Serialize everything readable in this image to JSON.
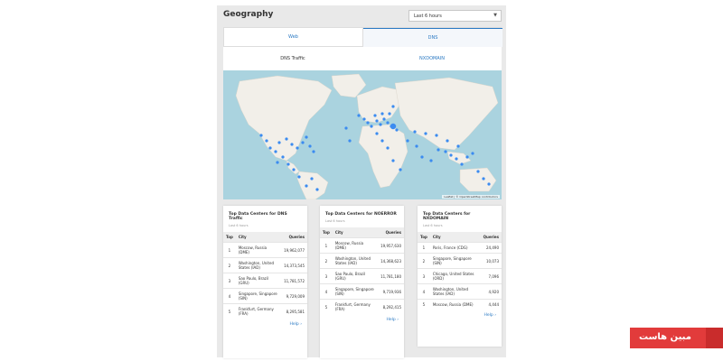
{
  "header": {
    "title": "Geography",
    "time_range": "Last 6 hours"
  },
  "tabs": [
    "Web",
    "DNS"
  ],
  "subtabs": [
    "DNS Traffic",
    "NXDOMAIN"
  ],
  "map": {
    "attribution": "Leaflet | © OpenStreetMap contributors"
  },
  "columns": {
    "top": "Top",
    "city": "City",
    "queries": "Queries"
  },
  "cards": [
    {
      "title": "Top Data Centers for DNS Traffic",
      "subtitle": "Last 6 hours",
      "rows": [
        {
          "rank": "1",
          "city": "Moscow, Russia (DME)",
          "queries": "19,962,077"
        },
        {
          "rank": "2",
          "city": "Washington, United States (IAD)",
          "queries": "14,373,545"
        },
        {
          "rank": "3",
          "city": "Sao Paulo, Brazil (GRU)",
          "queries": "11,781,572"
        },
        {
          "rank": "4",
          "city": "Singapore, Singapore (SIN)",
          "queries": "9,729,009"
        },
        {
          "rank": "5",
          "city": "Frankfurt, Germany (FRA)",
          "queries": "8,295,581"
        }
      ],
      "help": "Help ›"
    },
    {
      "title": "Top Data Centers for NOERROR",
      "subtitle": "Last 6 hours",
      "rows": [
        {
          "rank": "1",
          "city": "Moscow, Russia (DME)",
          "queries": "19,957,630"
        },
        {
          "rank": "2",
          "city": "Washington, United States (IAD)",
          "queries": "14,368,623"
        },
        {
          "rank": "3",
          "city": "Sao Paulo, Brazil (GRU)",
          "queries": "11,781,180"
        },
        {
          "rank": "4",
          "city": "Singapore, Singapore (SIN)",
          "queries": "9,719,936"
        },
        {
          "rank": "5",
          "city": "Frankfurt, Germany (FRA)",
          "queries": "8,292,415"
        }
      ],
      "help": "Help ›"
    },
    {
      "title": "Top Data Centers for NXDOMAIN",
      "subtitle": "Last 6 hours",
      "rows": [
        {
          "rank": "1",
          "city": "Paris, France (CDG)",
          "queries": "24,490"
        },
        {
          "rank": "2",
          "city": "Singapore, Singapore (SIN)",
          "queries": "10,073"
        },
        {
          "rank": "3",
          "city": "Chicago, United States (ORD)",
          "queries": "7,096"
        },
        {
          "rank": "4",
          "city": "Washington, United States (IAD)",
          "queries": "4,920"
        },
        {
          "rank": "5",
          "city": "Moscow, Russia (DME)",
          "queries": "4,444"
        }
      ],
      "help": "Help ›"
    }
  ],
  "brand": {
    "text": "مبین هاست",
    "color": "#e23b3b"
  },
  "colors": {
    "accent": "#2a79c3",
    "marker": "#3b8bf0",
    "ocean": "#aad3df",
    "land": "#f2efe9"
  }
}
